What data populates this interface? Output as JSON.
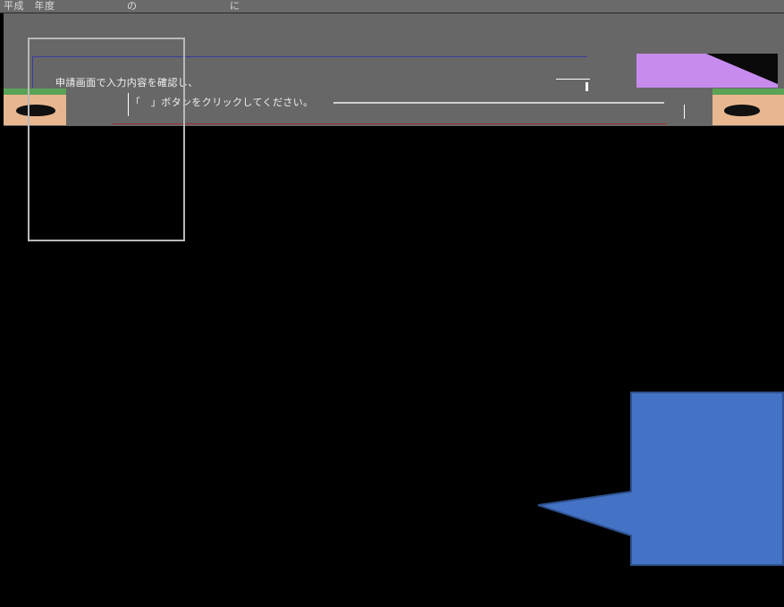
{
  "header": {
    "text": "平成　年度　　　　　　　の　　　　　　　　　に　　　　　　　　　　　　　　　　　　　　"
  },
  "instruction": {
    "line1": "申請画面で入力内容を確認し、　　　　　　　　　　　　　　　　　　　　　　　　　　　",
    "line2": "「　」ボタンをクリックしてください。"
  },
  "colors": {
    "banner": "#676767",
    "accent_purple": "#c78bee",
    "callout_fill": "#4472c4",
    "callout_stroke": "#2f528f",
    "face": "#e9b78f",
    "hair": "#5aa356"
  }
}
